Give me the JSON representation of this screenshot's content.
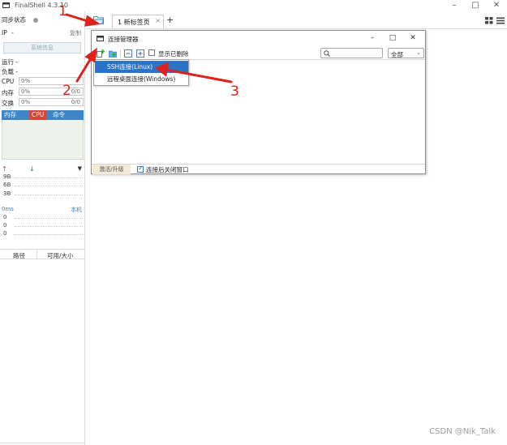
{
  "app": {
    "title": "FinalShell 4.3.10",
    "window_controls": {
      "minimize": "–",
      "maximize": "□",
      "close": "✕"
    }
  },
  "left_panel": {
    "sync_label": "同步状态",
    "ip_label": "IP",
    "ip_value": "-",
    "copy_label": "复制",
    "sysinfo_button": "系统信息",
    "run_label": "运行 -",
    "load_label": "负载 -",
    "meters": [
      {
        "label": "CPU",
        "value": "0%",
        "right": ""
      },
      {
        "label": "内存",
        "value": "0%",
        "right": "0/0"
      },
      {
        "label": "交换",
        "value": "0%",
        "right": "0/0"
      }
    ],
    "process_tabs": [
      "内存",
      "CPU",
      "命令"
    ],
    "net": {
      "up_arrow": "↑",
      "down_arrow": "↓",
      "menu_arrow": "▼",
      "labels": [
        "9B",
        "6B",
        "3B"
      ]
    },
    "latency": {
      "unit": "0ms",
      "host": "本机",
      "values": [
        "0",
        "0",
        "0"
      ]
    },
    "disk_columns": [
      "路径",
      "可用/大小"
    ]
  },
  "tabbar": {
    "tab_label": "1 新标签页",
    "tab_close": "×",
    "add": "+"
  },
  "dialog": {
    "title": "连接管理器",
    "minimize": "–",
    "maximize": "□",
    "close": "✕",
    "show_deleted_label": "显示已删除",
    "search_placeholder": "",
    "filter_value": "全部",
    "filter_arrow": "⌄",
    "activate_tab": "激活/升级",
    "close_after_connect_label": "连接后关闭窗口",
    "check_mark": "✓"
  },
  "menu": {
    "items": [
      "SSH连接(Linux)",
      "远程桌面连接(Windows)"
    ]
  },
  "annotations": {
    "labels": [
      "1",
      "2",
      "3"
    ],
    "color": "#e0201a"
  },
  "watermark": "CSDN @Nik_Talk",
  "colors": {
    "accent_blue": "#3f86c6",
    "menu_highlight": "#2b73c7",
    "cpu_tab_red": "#d04a3a"
  }
}
